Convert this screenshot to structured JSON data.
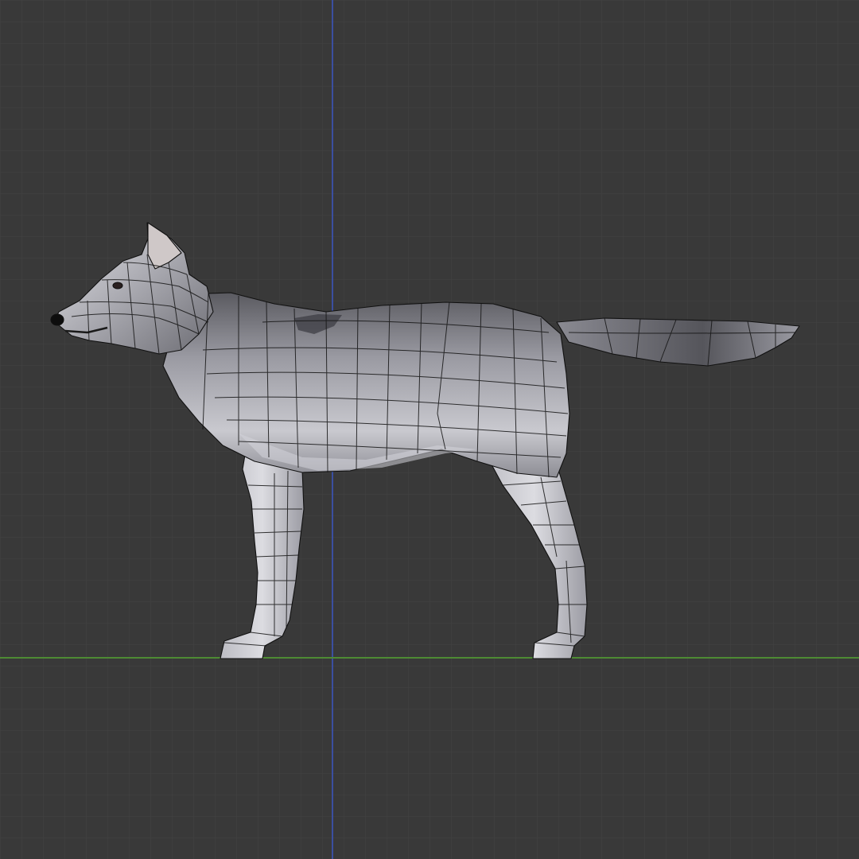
{
  "viewport": {
    "view": "3d-viewport-side-orthographic",
    "background_color": "#393939",
    "grid_color": "#444444",
    "axis_colors": {
      "vertical": "#3b4fa0",
      "horizontal": "#4d8a33"
    }
  },
  "object": {
    "kind": "wolf-mesh",
    "display": "textured-with-wireframe",
    "fur_colors": {
      "light": "#d9d9dc",
      "mid": "#a3a3aa",
      "dark": "#4a4a4f"
    }
  }
}
